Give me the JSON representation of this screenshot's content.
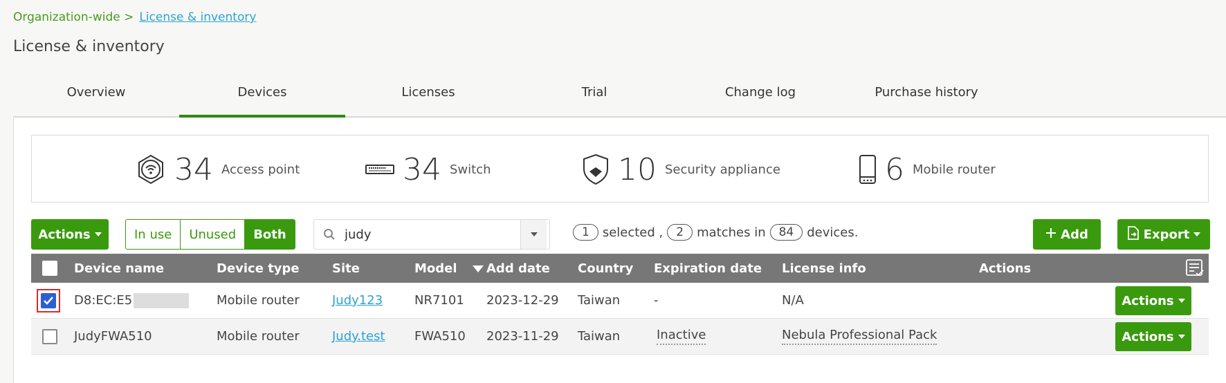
{
  "breadcrumb": {
    "parent": "Organization-wide >",
    "current": "License & inventory"
  },
  "page_title": "License & inventory",
  "tabs": [
    {
      "label": "Overview",
      "active": false
    },
    {
      "label": "Devices",
      "active": true
    },
    {
      "label": "Licenses",
      "active": false
    },
    {
      "label": "Trial",
      "active": false
    },
    {
      "label": "Change log",
      "active": false
    },
    {
      "label": "Purchase history",
      "active": false
    }
  ],
  "stats": [
    {
      "icon": "access-point-icon",
      "count": "34",
      "label": "Access point"
    },
    {
      "icon": "switch-icon",
      "count": "34",
      "label": "Switch"
    },
    {
      "icon": "security-appliance-icon",
      "count": "10",
      "label": "Security appliance"
    },
    {
      "icon": "mobile-router-icon",
      "count": "6",
      "label": "Mobile router"
    }
  ],
  "toolbar": {
    "actions_label": "Actions",
    "filter": {
      "in_use": "In use",
      "unused": "Unused",
      "both": "Both",
      "selected": "Both"
    },
    "search": {
      "value": "judy",
      "placeholder": ""
    },
    "selected_count": "1",
    "selected_text": "selected ,",
    "match_count": "2",
    "matches_text": "matches in",
    "total_count": "84",
    "devices_text": "devices.",
    "add_label": "Add",
    "export_label": "Export"
  },
  "table": {
    "columns": [
      "Device name",
      "Device type",
      "Site",
      "Model",
      "Add date",
      "Country",
      "Expiration date",
      "License info",
      "Actions"
    ],
    "rows": [
      {
        "checked": true,
        "device_name": "D8:EC:E5",
        "device_type": "Mobile router",
        "site": "Judy123",
        "model": "NR7101",
        "add_date": "2023-12-29",
        "country": "Taiwan",
        "expiration": "-",
        "license": "N/A",
        "action": "Actions"
      },
      {
        "checked": false,
        "device_name": "JudyFWA510",
        "device_type": "Mobile router",
        "site": "Judy.test",
        "model": "FWA510",
        "add_date": "2023-11-29",
        "country": "Taiwan",
        "expiration": "Inactive",
        "license": "Nebula Professional Pack",
        "action": "Actions"
      }
    ]
  },
  "colors": {
    "accent": "#3a9a0e",
    "link": "#2aa3d6",
    "header": "#777777",
    "checkbox": "#2b5fd4"
  }
}
